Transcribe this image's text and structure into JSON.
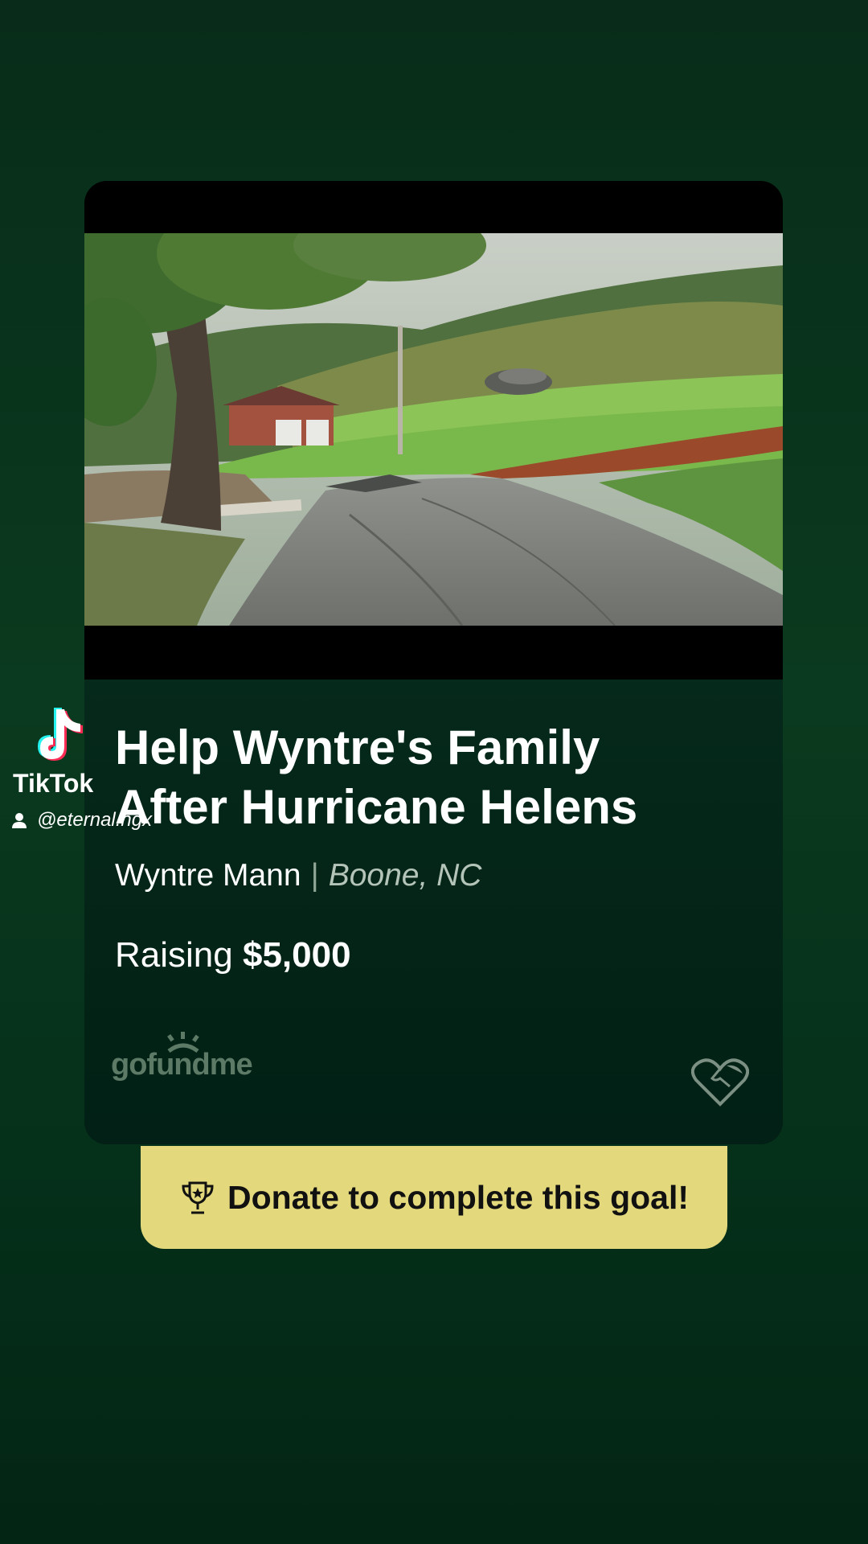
{
  "campaign": {
    "title_line1": "Help Wyntre's Family",
    "title_line2": "After Hurricane Helens",
    "organizer": "Wyntre Mann",
    "separator": "|",
    "location": "Boone, NC",
    "raising_prefix": "Raising",
    "goal_amount": "$5,000",
    "image_alt": "Flood-damaged road with debris near a house and hillside"
  },
  "branding": {
    "logo_text": "gofundme",
    "logo_icon": "sunrise-icon",
    "heart_icon": "heart-hands-icon"
  },
  "cta": {
    "label": "Donate to complete this goal!",
    "icon": "trophy-icon"
  },
  "overlay": {
    "brand": "TikTok",
    "handle": "@eternal.ngx",
    "icon": "tiktok-logo-icon"
  },
  "colors": {
    "background": "#0a3a1f",
    "button": "#e3d97c",
    "muted_text": "#b4c4b9"
  }
}
